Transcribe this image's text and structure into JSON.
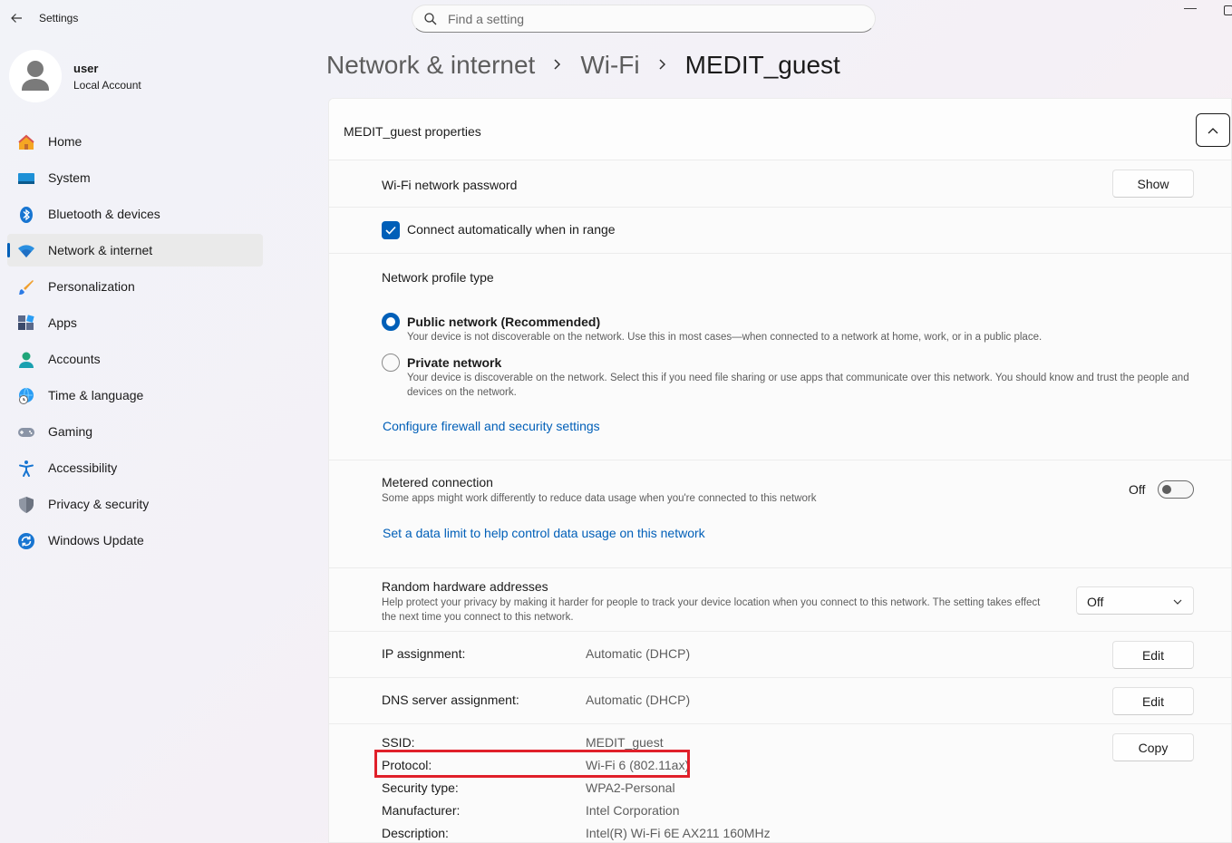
{
  "app": {
    "title": "Settings",
    "search_placeholder": "Find a setting"
  },
  "user": {
    "name": "user",
    "account_type": "Local Account"
  },
  "sidebar": {
    "items": [
      {
        "label": "Home",
        "icon": "home-icon"
      },
      {
        "label": "System",
        "icon": "system-icon"
      },
      {
        "label": "Bluetooth & devices",
        "icon": "bluetooth-icon"
      },
      {
        "label": "Network & internet",
        "icon": "wifi-icon",
        "active": true
      },
      {
        "label": "Personalization",
        "icon": "brush-icon"
      },
      {
        "label": "Apps",
        "icon": "apps-icon"
      },
      {
        "label": "Accounts",
        "icon": "accounts-icon"
      },
      {
        "label": "Time & language",
        "icon": "globe-clock-icon"
      },
      {
        "label": "Gaming",
        "icon": "gamepad-icon"
      },
      {
        "label": "Accessibility",
        "icon": "accessibility-icon"
      },
      {
        "label": "Privacy & security",
        "icon": "shield-icon"
      },
      {
        "label": "Windows Update",
        "icon": "update-icon"
      }
    ]
  },
  "breadcrumb": [
    "Network & internet",
    "Wi-Fi",
    "MEDIT_guest"
  ],
  "panel": {
    "title": "MEDIT_guest properties",
    "password": {
      "label": "Wi-Fi network password",
      "button": "Show"
    },
    "auto_connect": {
      "label": "Connect automatically when in range",
      "checked": true
    },
    "profile": {
      "heading": "Network profile type",
      "public_label": "Public network (Recommended)",
      "public_desc": "Your device is not discoverable on the network. Use this in most cases—when connected to a network at home, work, or in a public place.",
      "private_label": "Private network",
      "private_desc": "Your device is discoverable on the network. Select this if you need file sharing or use apps that communicate over this network. You should know and trust the people and devices on the network.",
      "selected": "public",
      "firewall_link": "Configure firewall and security settings"
    },
    "metered": {
      "label": "Metered connection",
      "desc": "Some apps might work differently to reduce data usage when you're connected to this network",
      "state": "Off",
      "data_limit_link": "Set a data limit to help control data usage on this network"
    },
    "random_hw": {
      "label": "Random hardware addresses",
      "desc": "Help protect your privacy by making it harder for people to track your device location when you connect to this network. The setting takes effect the next time you connect to this network.",
      "value": "Off"
    },
    "ip_assignment": {
      "label": "IP assignment:",
      "value": "Automatic (DHCP)",
      "button": "Edit"
    },
    "dns_assignment": {
      "label": "DNS server assignment:",
      "value": "Automatic (DHCP)",
      "button": "Edit"
    },
    "properties": {
      "copy_button": "Copy",
      "rows": [
        {
          "label": "SSID:",
          "value": "MEDIT_guest"
        },
        {
          "label": "Protocol:",
          "value": "Wi-Fi 6 (802.11ax)"
        },
        {
          "label": "Security type:",
          "value": "WPA2-Personal"
        },
        {
          "label": "Manufacturer:",
          "value": "Intel Corporation"
        },
        {
          "label": "Description:",
          "value": "Intel(R) Wi-Fi 6E AX211 160MHz"
        }
      ]
    }
  },
  "colors": {
    "accent": "#005fb8",
    "highlight": "#e0202a"
  }
}
